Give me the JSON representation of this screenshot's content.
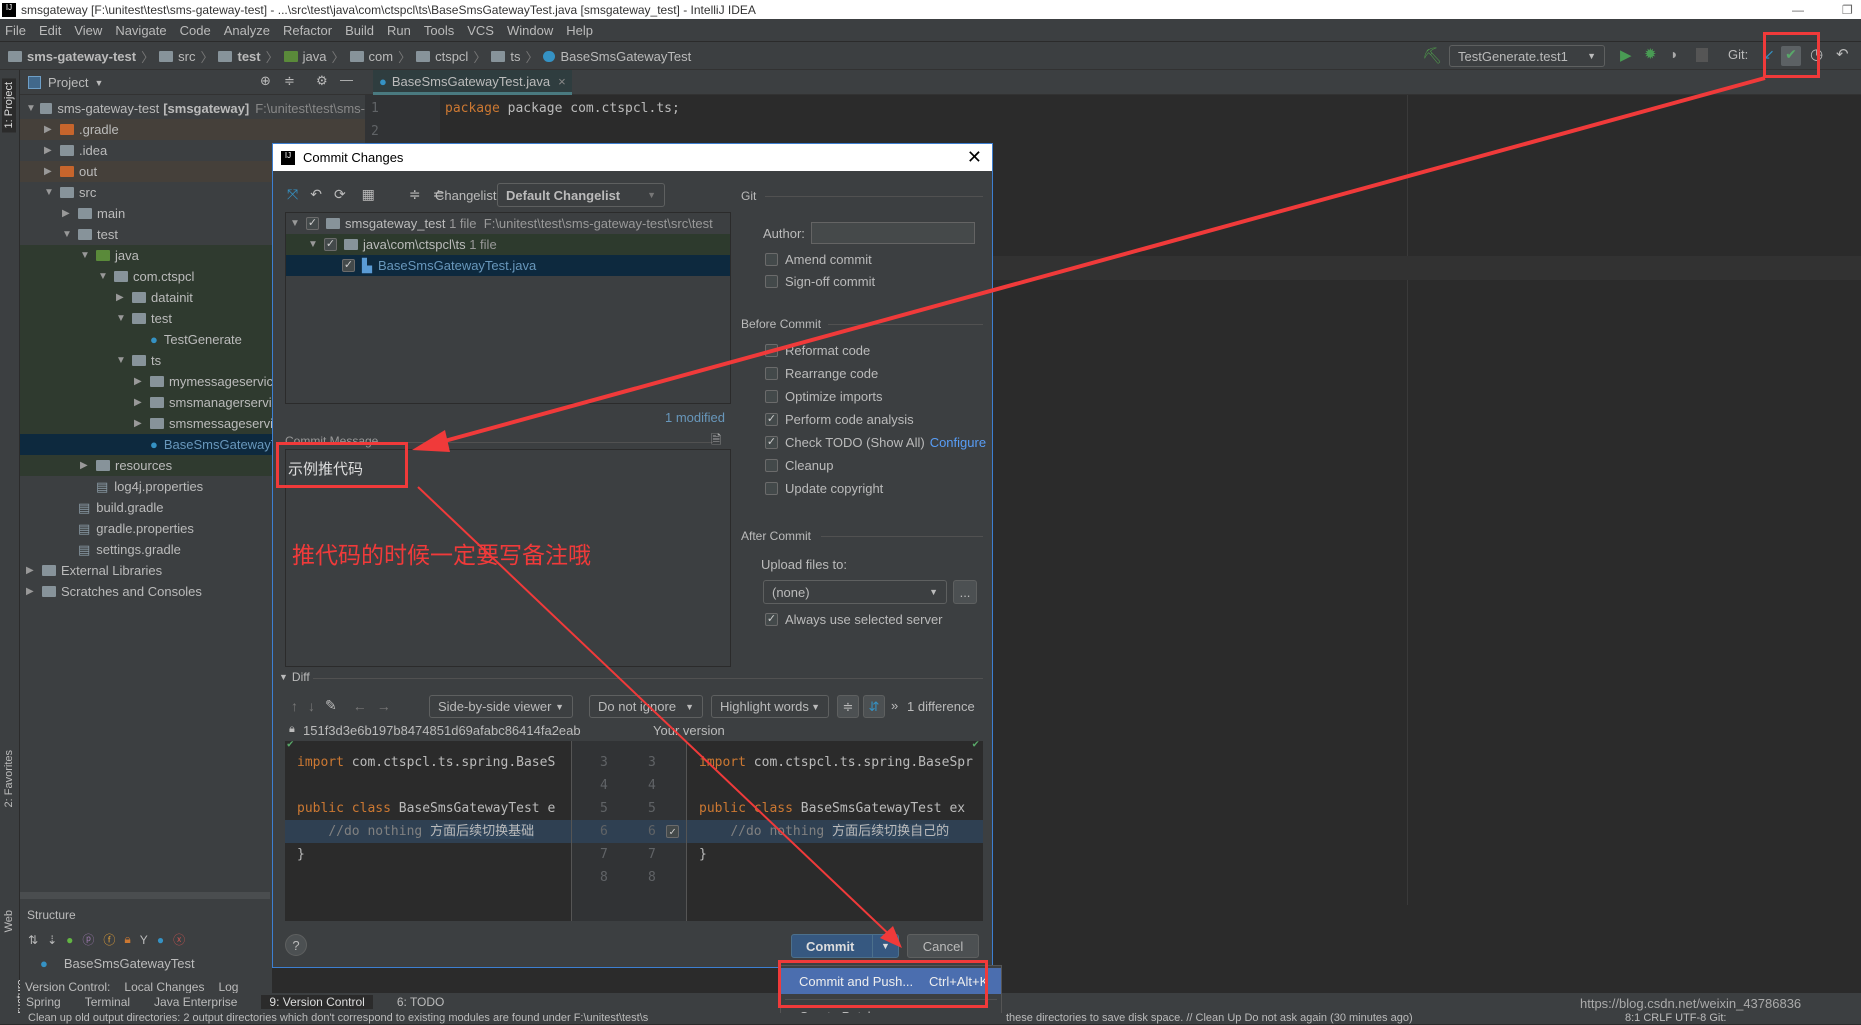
{
  "window": {
    "title": "smsgateway [F:\\unitest\\test\\sms-gateway-test] - ...\\src\\test\\java\\com\\ctspcl\\ts\\BaseSmsGatewayTest.java [smsgateway_test] - IntelliJ IDEA"
  },
  "menu": [
    "File",
    "Edit",
    "View",
    "Navigate",
    "Code",
    "Analyze",
    "Refactor",
    "Build",
    "Run",
    "Tools",
    "VCS",
    "Window",
    "Help"
  ],
  "breadcrumb": [
    "sms-gateway-test",
    "src",
    "test",
    "java",
    "com",
    "ctspcl",
    "ts",
    "BaseSmsGatewayTest"
  ],
  "toolbar": {
    "run_config": "TestGenerate.test1",
    "git_label": "Git:"
  },
  "project_panel": {
    "title": "Project",
    "tree": [
      {
        "label": "sms-gateway-test",
        "bold": "[smsgateway]",
        "path": "F:\\unitest\\test\\sms-",
        "depth": 0,
        "open": true
      },
      {
        "label": ".gradle",
        "depth": 1,
        "open": false
      },
      {
        "label": ".idea",
        "depth": 1,
        "open": false
      },
      {
        "label": "out",
        "depth": 1,
        "open": false
      },
      {
        "label": "src",
        "depth": 1,
        "open": true
      },
      {
        "label": "main",
        "depth": 2,
        "open": false
      },
      {
        "label": "test",
        "depth": 2,
        "open": true
      },
      {
        "label": "java",
        "depth": 3,
        "open": true
      },
      {
        "label": "com.ctspcl",
        "depth": 4,
        "open": true
      },
      {
        "label": "datainit",
        "depth": 5,
        "open": false
      },
      {
        "label": "test",
        "depth": 5,
        "open": true
      },
      {
        "label": "TestGenerate",
        "depth": 6,
        "leaf": true
      },
      {
        "label": "ts",
        "depth": 5,
        "open": true
      },
      {
        "label": "mymessageservice",
        "depth": 6,
        "open": false
      },
      {
        "label": "smsmanagerservice",
        "depth": 6,
        "open": false
      },
      {
        "label": "smsmessageservice",
        "depth": 6,
        "open": false
      },
      {
        "label": "BaseSmsGatewayTest",
        "depth": 6,
        "leaf": true,
        "selected": true
      },
      {
        "label": "resources",
        "depth": 3,
        "open": false
      },
      {
        "label": "log4j.properties",
        "depth": 3,
        "leaf": true
      },
      {
        "label": "build.gradle",
        "depth": 2,
        "leaf": true
      },
      {
        "label": "gradle.properties",
        "depth": 2,
        "leaf": true
      },
      {
        "label": "settings.gradle",
        "depth": 2,
        "leaf": true
      },
      {
        "label": "External Libraries",
        "depth": 0,
        "open": false
      },
      {
        "label": "Scratches and Consoles",
        "depth": 0,
        "open": false
      }
    ]
  },
  "editor": {
    "tab": "BaseSmsGatewayTest.java",
    "lines": [
      "1",
      "2"
    ],
    "code": "package com.ctspcl.ts;"
  },
  "structure": {
    "title": "Structure",
    "item": "BaseSmsGatewayTest"
  },
  "vc_tabs": {
    "label": "Version Control:",
    "tabs": [
      "Local Changes",
      "Log"
    ]
  },
  "side_tabs": {
    "project": "1: Project",
    "favorites": "2: Favorites",
    "web": "Web",
    "structure": "Z: Structure"
  },
  "dialog": {
    "title": "Commit Changes",
    "changelist_label": "Changelist:",
    "changelist": "Default Changelist",
    "changes": [
      {
        "name": "smsgateway_test",
        "meta": "1 file",
        "path": "F:\\unitest\\test\\sms-gateway-test\\src\\test"
      },
      {
        "name": "java\\com\\ctspcl\\ts",
        "meta": "1 file"
      },
      {
        "name": "BaseSmsGatewayTest.java"
      }
    ],
    "modified": "1 modified",
    "commit_message_label": "Commit Message",
    "commit_message": "示例推代码",
    "git_section": "Git",
    "author_label": "Author:",
    "author_value": "",
    "amend": {
      "label": "Amend commit",
      "checked": false
    },
    "signoff": {
      "label": "Sign-off commit",
      "checked": false
    },
    "before_commit_title": "Before Commit",
    "before_commit": [
      {
        "label": "Reformat code",
        "checked": false
      },
      {
        "label": "Rearrange code",
        "checked": false
      },
      {
        "label": "Optimize imports",
        "checked": false
      },
      {
        "label": "Perform code analysis",
        "checked": true
      },
      {
        "label": "Check TODO (Show All)",
        "checked": true,
        "link": "Configure"
      },
      {
        "label": "Cleanup",
        "checked": false
      },
      {
        "label": "Update copyright",
        "checked": false
      }
    ],
    "after_commit_title": "After Commit",
    "upload_label": "Upload files to:",
    "upload_value": "(none)",
    "browse": "...",
    "always_server": {
      "label": "Always use selected server",
      "checked": true
    },
    "diff": {
      "title": "Diff",
      "viewer": "Side-by-side viewer",
      "ignore": "Do not ignore",
      "highlight": "Highlight words",
      "differences": "1 difference",
      "left_rev": "151f3d3e6b197b8474851d69afabc86414fa2eab",
      "right_rev": "Your version",
      "left_lines": [
        "3",
        "4",
        "5",
        "6",
        "7",
        "8"
      ],
      "right_lines": [
        "3",
        "4",
        "5",
        "6",
        "7",
        "8"
      ],
      "left_code": [
        "import com.ctspcl.ts.spring.BaseS",
        "",
        "public class BaseSmsGatewayTest e",
        "    //do nothing 方面后续切换基础",
        "}",
        ""
      ],
      "right_code": [
        "import com.ctspcl.ts.spring.BaseSpr",
        "",
        "public class BaseSmsGatewayTest ex",
        "    //do nothing 方面后续切换自己的",
        "}",
        ""
      ]
    },
    "help": "?",
    "commit_button": "Commit",
    "cancel_button": "Cancel"
  },
  "popup": {
    "items": [
      {
        "label": "Commit and Push...",
        "shortcut": "Ctrl+Alt+K",
        "active": true
      },
      {
        "label": "Create Patch..."
      }
    ]
  },
  "annotation": {
    "note": "推代码的时候一定要写备注哦",
    "color": "#f03a3a"
  },
  "bottom_tabs": [
    "Spring",
    "Terminal",
    "Java Enterprise",
    "9: Version Control",
    "6: TODO"
  ],
  "status": {
    "left": "Clean up old output directories: 2 output directories which don't correspond to existing modules are found under F:\\unitest\\test\\s",
    "right": "these directories to save disk space. // Clean Up  Do not ask again (30 minutes ago)",
    "pos": "8:1  CRLF  UTF-8  Git:"
  },
  "watermark": "https://blog.csdn.net/weixin_43786836"
}
